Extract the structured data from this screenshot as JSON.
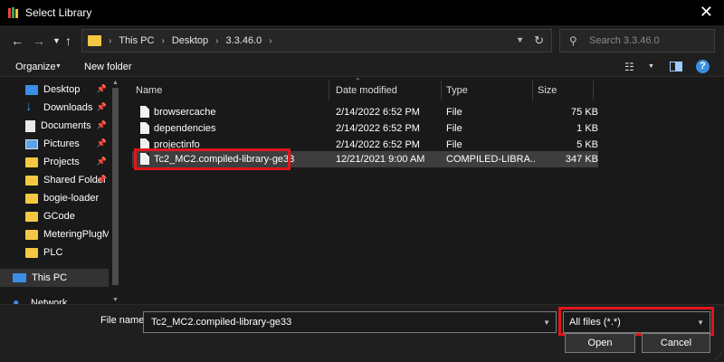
{
  "window": {
    "title": "Select Library",
    "app_icon": "library-books-icon",
    "close_icon": "close-icon"
  },
  "navigation": {
    "back_icon": "arrow-left-icon",
    "forward_icon": "arrow-right-icon",
    "recent_icon": "chevron-down-icon",
    "up_icon": "arrow-up-icon",
    "breadcrumbs": [
      "This PC",
      "Desktop",
      "3.3.46.0"
    ],
    "refresh_icon": "refresh-icon",
    "search_placeholder": "Search 3.3.46.0"
  },
  "toolbar": {
    "organize_label": "Organize",
    "new_folder_label": "New folder",
    "view_icon": "view-options-icon",
    "preview_pane_icon": "preview-pane-icon",
    "help_label": "?"
  },
  "sidebar": {
    "items": [
      {
        "label": "Desktop",
        "icon": "desktop-icon",
        "pinned": true
      },
      {
        "label": "Downloads",
        "icon": "download-icon",
        "pinned": true
      },
      {
        "label": "Documents",
        "icon": "document-icon",
        "pinned": true
      },
      {
        "label": "Pictures",
        "icon": "pictures-icon",
        "pinned": true
      },
      {
        "label": "Projects",
        "icon": "folder-icon",
        "pinned": true
      },
      {
        "label": "Shared Folder",
        "icon": "folder-icon",
        "pinned": true
      },
      {
        "label": "bogie-loader",
        "icon": "folder-icon",
        "pinned": false
      },
      {
        "label": "GCode",
        "icon": "folder-icon",
        "pinned": false
      },
      {
        "label": "MeteringPlugMa",
        "icon": "folder-icon",
        "pinned": false
      },
      {
        "label": "PLC",
        "icon": "folder-icon",
        "pinned": false
      },
      {
        "label": "This PC",
        "icon": "computer-icon",
        "pinned": false,
        "selected": true
      },
      {
        "label": "Network",
        "icon": "network-icon",
        "pinned": false
      }
    ]
  },
  "file_list": {
    "columns": [
      "Name",
      "Date modified",
      "Type",
      "Size"
    ],
    "rows": [
      {
        "name": "browsercache",
        "date": "2/14/2022 6:52 PM",
        "type": "File",
        "size": "75 KB"
      },
      {
        "name": "dependencies",
        "date": "2/14/2022 6:52 PM",
        "type": "File",
        "size": "1 KB"
      },
      {
        "name": "projectinfo",
        "date": "2/14/2022 6:52 PM",
        "type": "File",
        "size": "5 KB"
      },
      {
        "name": "Tc2_MC2.compiled-library-ge33",
        "date": "12/21/2021 9:00 AM",
        "type": "COMPILED-LIBRA...",
        "size": "347 KB",
        "selected": true
      }
    ]
  },
  "footer": {
    "file_name_label": "File name:",
    "file_name_value": "Tc2_MC2.compiled-library-ge33",
    "file_type_value": "All files (*.*)",
    "open_label": "Open",
    "cancel_label": "Cancel"
  },
  "colors": {
    "highlight": "#e0161b",
    "background": "#191919",
    "accent": "#3a8ee6",
    "folder": "#f5c843"
  }
}
